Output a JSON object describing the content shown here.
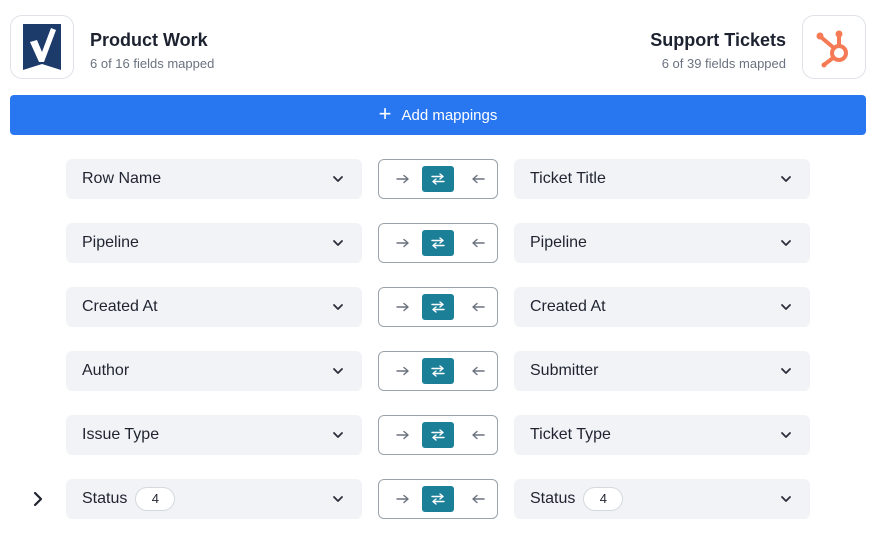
{
  "left_app": {
    "name": "Product Work",
    "subtitle": "6 of 16 fields mapped",
    "logo_icon": "smartsheet-logo-icon",
    "logo_color": "#1c3b6b"
  },
  "right_app": {
    "name": "Support Tickets",
    "subtitle": "6 of 39 fields mapped",
    "logo_icon": "hubspot-logo-icon",
    "logo_color": "#f57a56"
  },
  "add_button": {
    "label": "Add mappings",
    "icon": "plus-icon",
    "color": "#2977f0"
  },
  "direction_colors": {
    "active": "#1b7f98",
    "inactive_arrow": "#6b7280"
  },
  "mappings": [
    {
      "left": "Row Name",
      "right": "Ticket Title",
      "direction": "both"
    },
    {
      "left": "Pipeline",
      "right": "Pipeline",
      "direction": "both"
    },
    {
      "left": "Created At",
      "right": "Created At",
      "direction": "both"
    },
    {
      "left": "Author",
      "right": "Submitter",
      "direction": "both"
    },
    {
      "left": "Issue Type",
      "right": "Ticket Type",
      "direction": "both"
    },
    {
      "left": "Status",
      "left_badge": "4",
      "right": "Status",
      "right_badge": "4",
      "direction": "both",
      "expandable": true
    }
  ]
}
